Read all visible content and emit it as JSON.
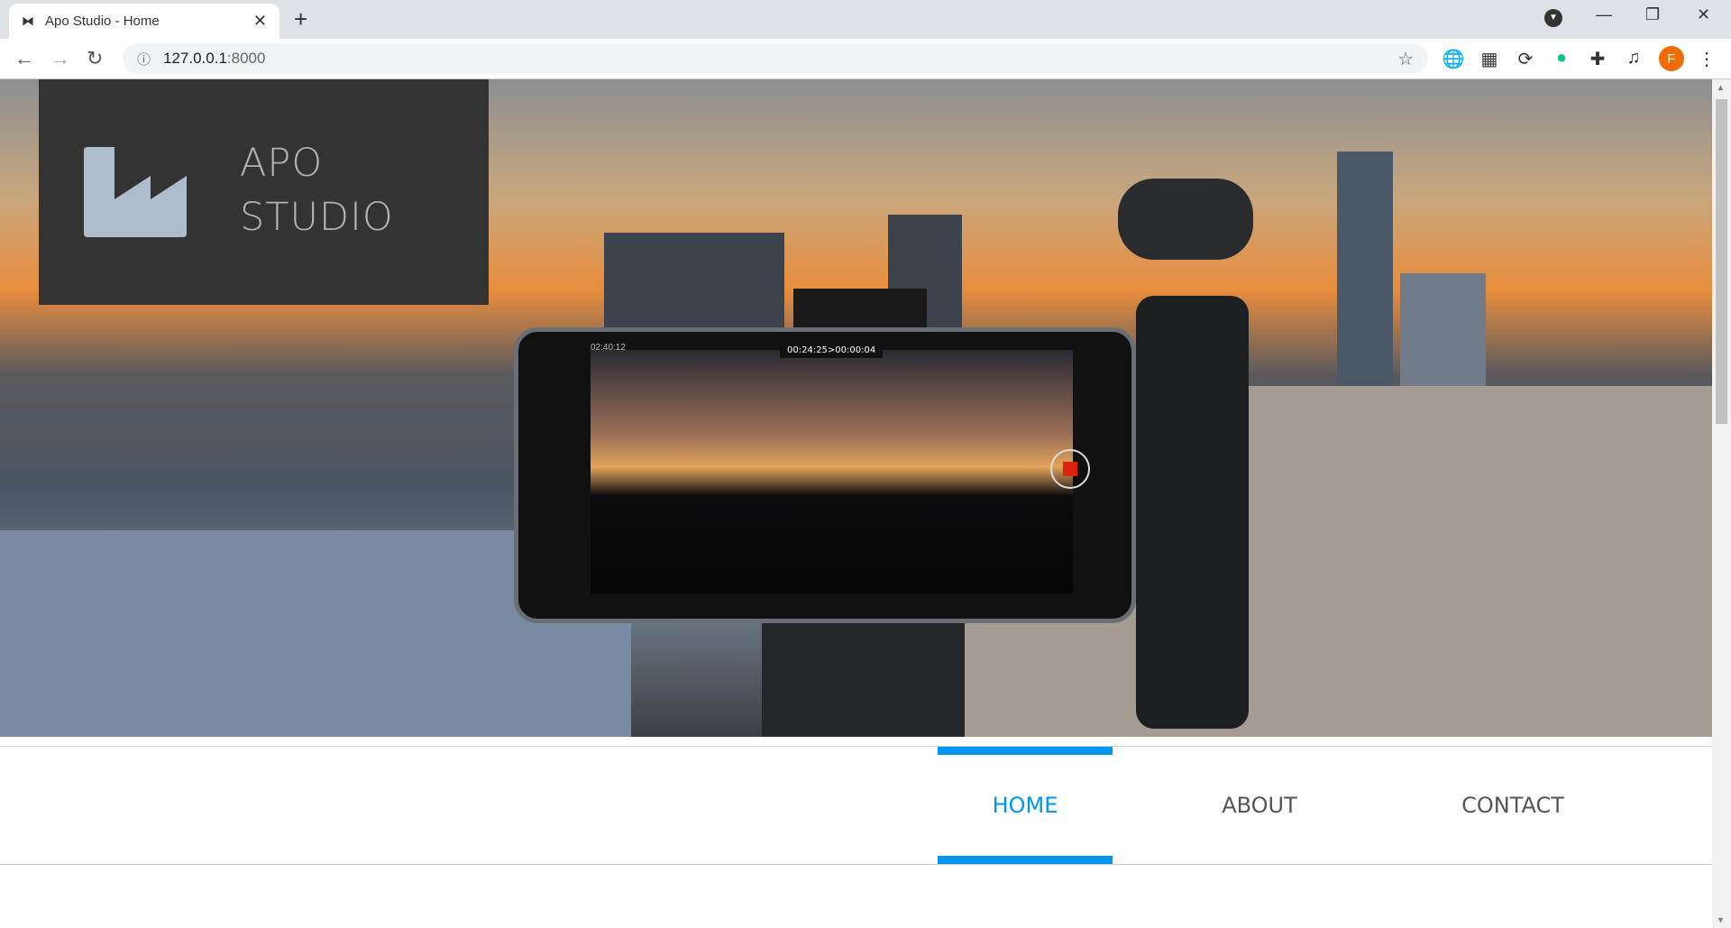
{
  "browser": {
    "tab_title": "Apo Studio - Home",
    "url_host": "127.0.0.1",
    "url_port": ":8000",
    "profile_initial": "F",
    "extensions": [
      "idm-icon",
      "grid-icon",
      "sync-icon",
      "grammarly-icon",
      "puzzle-icon",
      "media-icon"
    ]
  },
  "logo": {
    "line1": "APO",
    "line2": "STUDIO",
    "icon": "factory-icon",
    "icon_color": "#aebccb"
  },
  "hero": {
    "rec_time": "00:24:25>00:00:04",
    "left_time": "02:40:12"
  },
  "nav": {
    "items": [
      {
        "label": "HOME",
        "active": true
      },
      {
        "label": "ABOUT"
      },
      {
        "label": "CONTACT"
      }
    ],
    "accent": "#0096f0"
  }
}
